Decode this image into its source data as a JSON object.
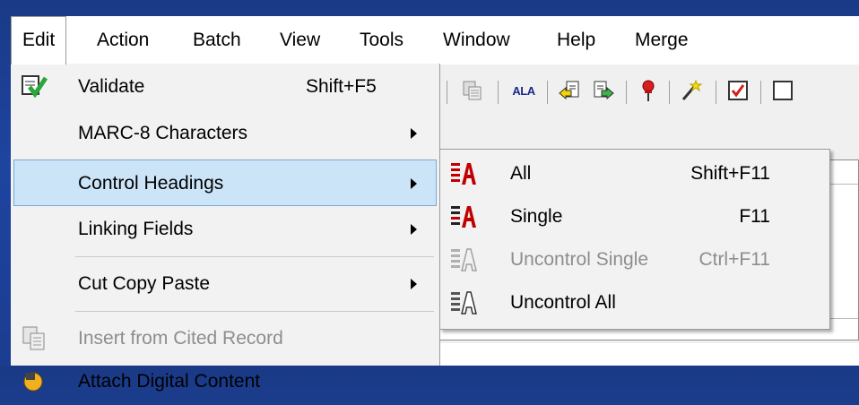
{
  "menubar": {
    "items": [
      {
        "label": "Edit"
      },
      {
        "label": "Action"
      },
      {
        "label": "Batch"
      },
      {
        "label": "View"
      },
      {
        "label": "Tools"
      },
      {
        "label": "Window"
      },
      {
        "label": "Help"
      },
      {
        "label": "Merge"
      }
    ]
  },
  "toolbar": {
    "icons": [
      "paste-record-icon",
      "ala-icon",
      "previous-record-icon",
      "next-record-icon",
      "pushpin-icon",
      "magic-wand-icon",
      "checkbox-icon"
    ],
    "ala_text": "ALA"
  },
  "edit_menu": {
    "items": [
      {
        "label": "Validate",
        "shortcut": "Shift+F5",
        "icon": "validate-check-icon"
      },
      {
        "label": "MARC-8 Characters",
        "submenu": true
      },
      {
        "label": "Control Headings",
        "submenu": true,
        "selected": true
      },
      {
        "label": "Linking Fields",
        "submenu": true
      },
      {
        "label": "Cut Copy Paste",
        "submenu": true
      },
      {
        "label": "Insert from Cited Record",
        "disabled": true,
        "icon": "cited-record-icon"
      },
      {
        "label": "Attach Digital Content",
        "icon": "attach-digital-content-icon"
      }
    ]
  },
  "control_headings_submenu": {
    "items": [
      {
        "label": "All",
        "shortcut": "Shift+F11",
        "icon": "control-all-icon"
      },
      {
        "label": "Single",
        "shortcut": "F11",
        "icon": "control-single-icon"
      },
      {
        "label": "Uncontrol Single",
        "shortcut": "Ctrl+F11",
        "disabled": true,
        "icon": "uncontrol-single-icon"
      },
      {
        "label": "Uncontrol All",
        "icon": "uncontrol-all-icon"
      }
    ]
  },
  "colors": {
    "desktop_background": "#1e44a0",
    "menu_background": "#f2f2f2",
    "selection_background": "#cce4f7",
    "selection_border": "#7aa8d8",
    "disabled_text": "#8d8d8d"
  }
}
